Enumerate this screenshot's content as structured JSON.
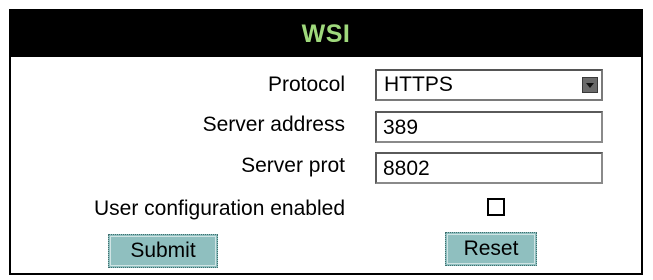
{
  "panel": {
    "title": "WSI"
  },
  "form": {
    "protocol": {
      "label": "Protocol",
      "selected": "HTTPS"
    },
    "server_address": {
      "label": "Server address",
      "value": "389"
    },
    "server_port": {
      "label": "Server prot",
      "value": "8802"
    },
    "user_configuration": {
      "label": "User configuration enabled",
      "checked": false
    }
  },
  "actions": {
    "submit_label": "Submit",
    "reset_label": "Reset"
  },
  "colors": {
    "title_text": "#9fd97c",
    "title_background": "#000000",
    "button_background": "#8fbfbf"
  }
}
